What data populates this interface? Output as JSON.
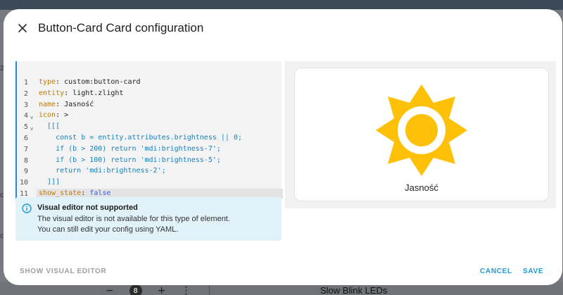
{
  "dialog": {
    "title": "Button-Card Card configuration"
  },
  "editor": {
    "lines": [
      {
        "num": "1",
        "key": "type",
        "sep": ": ",
        "value": "custom:button-card",
        "fold": ""
      },
      {
        "num": "2",
        "key": "entity",
        "sep": ": ",
        "value": "light.zlight",
        "fold": ""
      },
      {
        "num": "3",
        "key": "name",
        "sep": ": ",
        "value": "Jasność",
        "fold": ""
      },
      {
        "num": "4",
        "key": "icon",
        "sep": ": ",
        "value": ">",
        "fold": "v"
      },
      {
        "num": "5",
        "key": "",
        "sep": "",
        "value": "  [[[",
        "fold": "v"
      },
      {
        "num": "6",
        "key": "",
        "sep": "",
        "value": "    const b = entity.attributes.brightness || 0;",
        "fold": ""
      },
      {
        "num": "7",
        "key": "",
        "sep": "",
        "value": "    if (b > 200) return 'mdi:brightness-7';",
        "fold": ""
      },
      {
        "num": "8",
        "key": "",
        "sep": "",
        "value": "    if (b > 100) return 'mdi:brightness-5';",
        "fold": ""
      },
      {
        "num": "9",
        "key": "",
        "sep": "",
        "value": "    return 'mdi:brightness-2';",
        "fold": ""
      },
      {
        "num": "10",
        "key": "",
        "sep": "",
        "value": "  ]]]",
        "fold": ""
      },
      {
        "num": "11",
        "key": "show_state",
        "sep": ": ",
        "value": "false",
        "fold": ""
      }
    ]
  },
  "alert": {
    "title": "Visual editor not supported",
    "line1": "The visual editor is not available for this type of element.",
    "line2": "You can still edit your config using YAML."
  },
  "preview": {
    "name": "Jasność",
    "icon": "brightness-7-icon",
    "icon_color": "#ffc107"
  },
  "footer": {
    "show_visual_editor": "SHOW VISUAL EDITOR",
    "cancel": "CANCEL",
    "save": "SAVE"
  },
  "background": {
    "badge": "8",
    "minus": "−",
    "plus": "+",
    "menu": "⋮",
    "label": "Slow Blink LEDs"
  },
  "colors": {
    "accent": "#1e9ad6",
    "editor_border": "#1c8ce0",
    "alert_bg": "#e1f2f9"
  }
}
